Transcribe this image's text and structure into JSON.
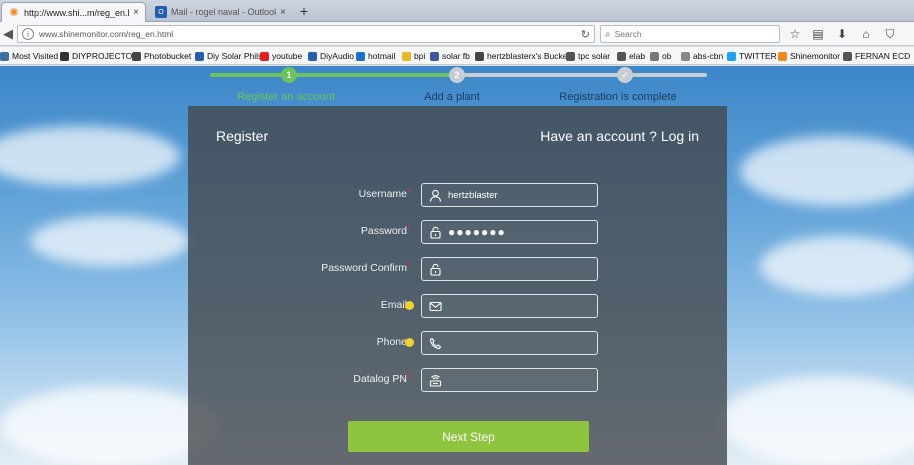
{
  "browser": {
    "tabs": [
      {
        "title": "http://www.shi...m/reg_en.html",
        "active": true,
        "icon": "sun-favicon-icon"
      },
      {
        "title": "Mail - rogel naval - Outlook",
        "active": false,
        "icon": "outlook-favicon-icon"
      }
    ],
    "close_glyph": "×",
    "new_tab_glyph": "+",
    "url": "www.shinemonitor.com/reg_en.html",
    "search_placeholder": "Search",
    "bookmarks": [
      {
        "label": "Most Visited",
        "color": "#3a6ea5"
      },
      {
        "label": "DIYPROJECTOR",
        "color": "#333333"
      },
      {
        "label": "Photobucket",
        "color": "#444444"
      },
      {
        "label": "Diy Solar Phils",
        "color": "#2a5db0"
      },
      {
        "label": "youtube",
        "color": "#e02020"
      },
      {
        "label": "DiyAudio",
        "color": "#2a5db0"
      },
      {
        "label": "hotmail",
        "color": "#1a73c8"
      },
      {
        "label": "bpi",
        "color": "#e8b820"
      },
      {
        "label": "solar fb",
        "color": "#3b5998"
      },
      {
        "label": "hertzblasterx's Bucket",
        "color": "#444444"
      },
      {
        "label": "tpc solar",
        "color": "#555555"
      },
      {
        "label": "elab",
        "color": "#555555"
      },
      {
        "label": "ob",
        "color": "#777777"
      },
      {
        "label": "abs-cbn",
        "color": "#888888"
      },
      {
        "label": "TWITTER",
        "color": "#1da1f2"
      },
      {
        "label": "Shinemonitor",
        "color": "#f08a1c"
      },
      {
        "label": "FERNAN ECD",
        "color": "#555555"
      }
    ]
  },
  "steps": [
    {
      "number": "1",
      "label": "Register an account",
      "state": "active"
    },
    {
      "number": "2",
      "label": "Add a plant",
      "state": "pending"
    },
    {
      "number": "✓",
      "label": "Registration is complete",
      "state": "pending"
    }
  ],
  "form": {
    "title": "Register",
    "login_prompt": "Have an account ?  Log in",
    "fields": [
      {
        "label": "Username",
        "value": "hertzblaster",
        "icon": "user-icon",
        "marker": "required"
      },
      {
        "label": "Password",
        "value": "●●●●●●●",
        "icon": "lock-icon",
        "marker": "required"
      },
      {
        "label": "Password Confirm",
        "value": "",
        "icon": "lock-icon",
        "marker": "required"
      },
      {
        "label": "Email",
        "value": "",
        "icon": "mail-icon",
        "marker": "optional"
      },
      {
        "label": "Phone",
        "value": "",
        "icon": "phone-icon",
        "marker": "optional"
      },
      {
        "label": "Datalog PN",
        "value": "",
        "icon": "datalogger-icon",
        "marker": "required"
      }
    ],
    "required_mark": "*",
    "next_label": "Next Step"
  },
  "colors": {
    "accent_green": "#8fc43f",
    "step_active": "#6ec25c",
    "step_inactive": "#c8cdd3",
    "required": "#d33333",
    "optional_dot": "#f2d12a"
  }
}
